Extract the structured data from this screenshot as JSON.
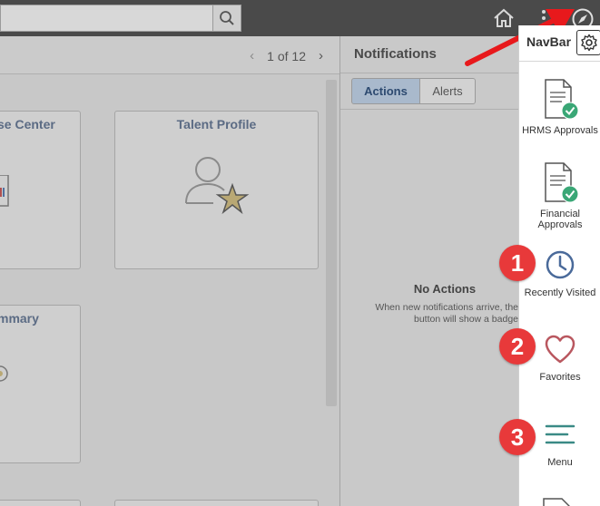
{
  "header": {
    "search_placeholder": ""
  },
  "content": {
    "pager": {
      "prev": "‹",
      "text": "1 of 12",
      "next": "›"
    },
    "tiles": [
      {
        "title": "se Center"
      },
      {
        "title": "Talent Profile"
      },
      {
        "title": "mmary"
      }
    ]
  },
  "notifications": {
    "title": "Notifications",
    "tabs": {
      "actions": "Actions",
      "alerts": "Alerts"
    },
    "empty_title": "No Actions",
    "empty_desc": "When new notifications arrive, the button will show a badge"
  },
  "navbar": {
    "title": "NavBar",
    "items": [
      {
        "label": "HRMS Approvals"
      },
      {
        "label": "Financial Approvals"
      },
      {
        "label": "Recently Visited"
      },
      {
        "label": "Favorites"
      },
      {
        "label": "Menu"
      }
    ]
  },
  "annotations": {
    "badges": [
      "1",
      "2",
      "3"
    ]
  },
  "colors": {
    "badge": "#e8393a",
    "arrow": "#e8191c",
    "check_green": "#3aa776",
    "clock_blue": "#4a6a9a",
    "heart_red": "#b9575f",
    "menu_teal": "#3a8a86"
  }
}
